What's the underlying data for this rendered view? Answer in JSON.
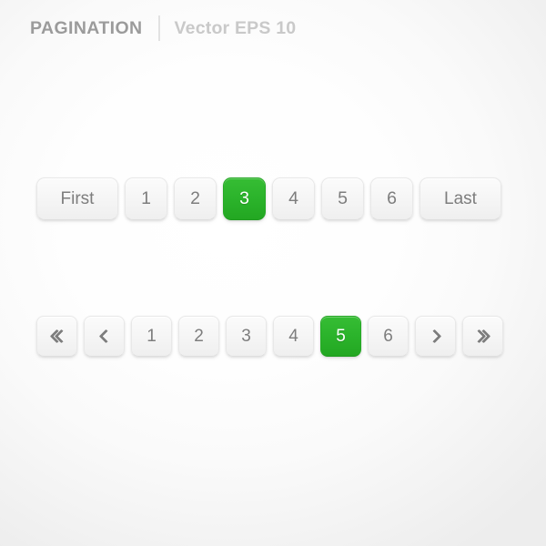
{
  "header": {
    "title": "PAGINATION",
    "divider": "|",
    "subtitle": "Vector EPS 10"
  },
  "colors": {
    "active_green": "#2bb32b",
    "button_face": "#f6f6f6",
    "button_text": "#7d7d7d",
    "title_text": "#9b9b9b",
    "subtitle_text": "#c9c9c9",
    "page_background": "#ffffff",
    "page_edge": "#ededed"
  },
  "pagination_primary": {
    "name": "pagination-row-labeled",
    "active_page": "3",
    "items": [
      {
        "label": "First",
        "type": "label",
        "active": false,
        "icon": ""
      },
      {
        "label": "1",
        "type": "page",
        "active": false,
        "icon": ""
      },
      {
        "label": "2",
        "type": "page",
        "active": false,
        "icon": ""
      },
      {
        "label": "3",
        "type": "page",
        "active": true,
        "icon": ""
      },
      {
        "label": "4",
        "type": "page",
        "active": false,
        "icon": ""
      },
      {
        "label": "5",
        "type": "page",
        "active": false,
        "icon": ""
      },
      {
        "label": "6",
        "type": "page",
        "active": false,
        "icon": ""
      },
      {
        "label": "Last",
        "type": "label",
        "active": false,
        "icon": ""
      }
    ]
  },
  "pagination_secondary": {
    "name": "pagination-row-arrows",
    "active_page": "5",
    "items": [
      {
        "label": "",
        "type": "arrow",
        "active": false,
        "icon": "double-chevron-left-icon"
      },
      {
        "label": "",
        "type": "arrow",
        "active": false,
        "icon": "chevron-left-icon"
      },
      {
        "label": "1",
        "type": "page",
        "active": false,
        "icon": ""
      },
      {
        "label": "2",
        "type": "page",
        "active": false,
        "icon": ""
      },
      {
        "label": "3",
        "type": "page",
        "active": false,
        "icon": ""
      },
      {
        "label": "4",
        "type": "page",
        "active": false,
        "icon": ""
      },
      {
        "label": "5",
        "type": "page",
        "active": true,
        "icon": ""
      },
      {
        "label": "6",
        "type": "page",
        "active": false,
        "icon": ""
      },
      {
        "label": "",
        "type": "arrow",
        "active": false,
        "icon": "chevron-right-icon"
      },
      {
        "label": "",
        "type": "arrow",
        "active": false,
        "icon": "double-chevron-right-icon"
      }
    ]
  }
}
